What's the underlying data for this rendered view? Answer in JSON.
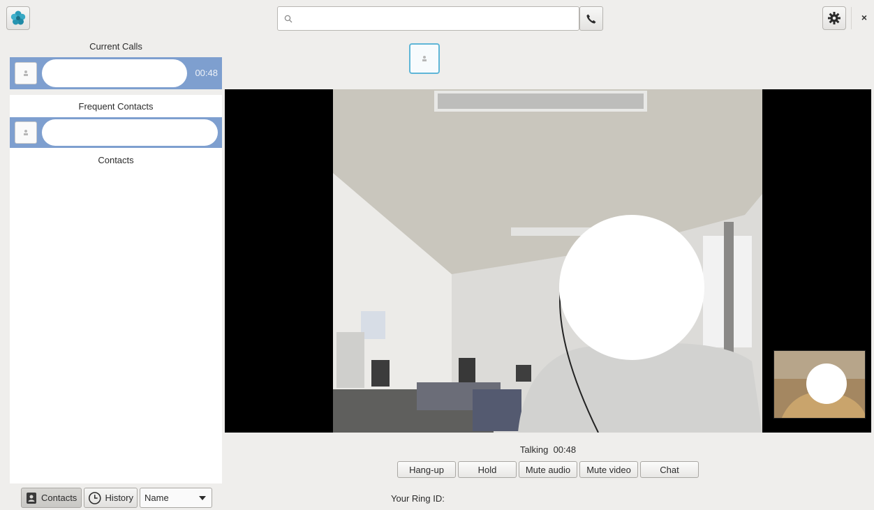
{
  "toolbar": {
    "logo_icon": "ring-flower-logo-icon",
    "search_placeholder": "",
    "call_icon": "phone-icon",
    "settings_icon": "gear-icon",
    "close_label": "×"
  },
  "sidebar": {
    "current_calls_title": "Current Calls",
    "current_call": {
      "duration": "00:48",
      "selected_color": "#7e9fcf"
    },
    "frequent_contacts_title": "Frequent Contacts",
    "contacts_title": "Contacts",
    "tabs": [
      {
        "label": "Contacts",
        "icon": "address-book-icon",
        "active": true
      },
      {
        "label": "History",
        "icon": "clock-icon",
        "active": false
      }
    ],
    "sort": {
      "selected": "Name"
    }
  },
  "call": {
    "status_label": "Talking",
    "duration": "00:48",
    "buttons": {
      "hangup": "Hang-up",
      "hold": "Hold",
      "mute_audio": "Mute audio",
      "mute_video": "Mute video",
      "chat": "Chat"
    },
    "ring_id_label": "Your Ring ID:"
  },
  "colors": {
    "accent": "#5fb6d7",
    "selection": "#7e9fcf",
    "background": "#efeeec"
  }
}
